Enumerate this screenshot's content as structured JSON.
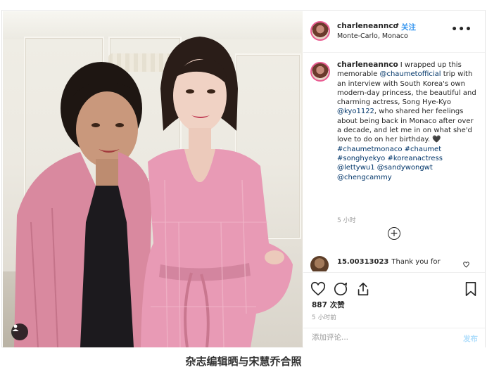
{
  "post": {
    "username": "charleneannco",
    "follow_sep": "•",
    "follow_label": "关注",
    "location": "Monte-Carlo, Monaco",
    "more_label": "•••",
    "caption": {
      "username": "charleneannco",
      "text_1": "I wrapped up this memorable ",
      "mention_1": "@chaumetofficial",
      "text_2": " trip with an interview with South Korea's own modern-day princess, the beautiful and charming actress, Song Hye-Kyo ",
      "mention_2": "@kyo1122",
      "text_3": ", who shared her feelings about being back in Monaco after over a decade, and let me in on what she'd love to do on her birthday. 🖤",
      "tags": "#chaumetmonaco #chaumet #songhyekyo #koreanactress @lettywu1 @sandywongwt @chengcammy"
    },
    "caption_time": "5 小时",
    "comment": {
      "username": "15.00313023",
      "text": "Thank you for"
    },
    "likes": "887 次赞",
    "post_time": "5 小时前",
    "add_comment_placeholder": "添加评论...",
    "post_label": "发布"
  },
  "page_caption": "杂志编辑晒与宋慧乔合照",
  "colors": {
    "link_blue": "#3897f0",
    "mention": "#003569",
    "story_ring": "#e95c92",
    "dress_pink": "#e89ab5"
  },
  "icons": [
    "user-tag-icon",
    "more-icon",
    "add-comment-icon",
    "heart-icon",
    "comment-icon",
    "share-icon",
    "bookmark-icon",
    "like-comment-icon"
  ]
}
